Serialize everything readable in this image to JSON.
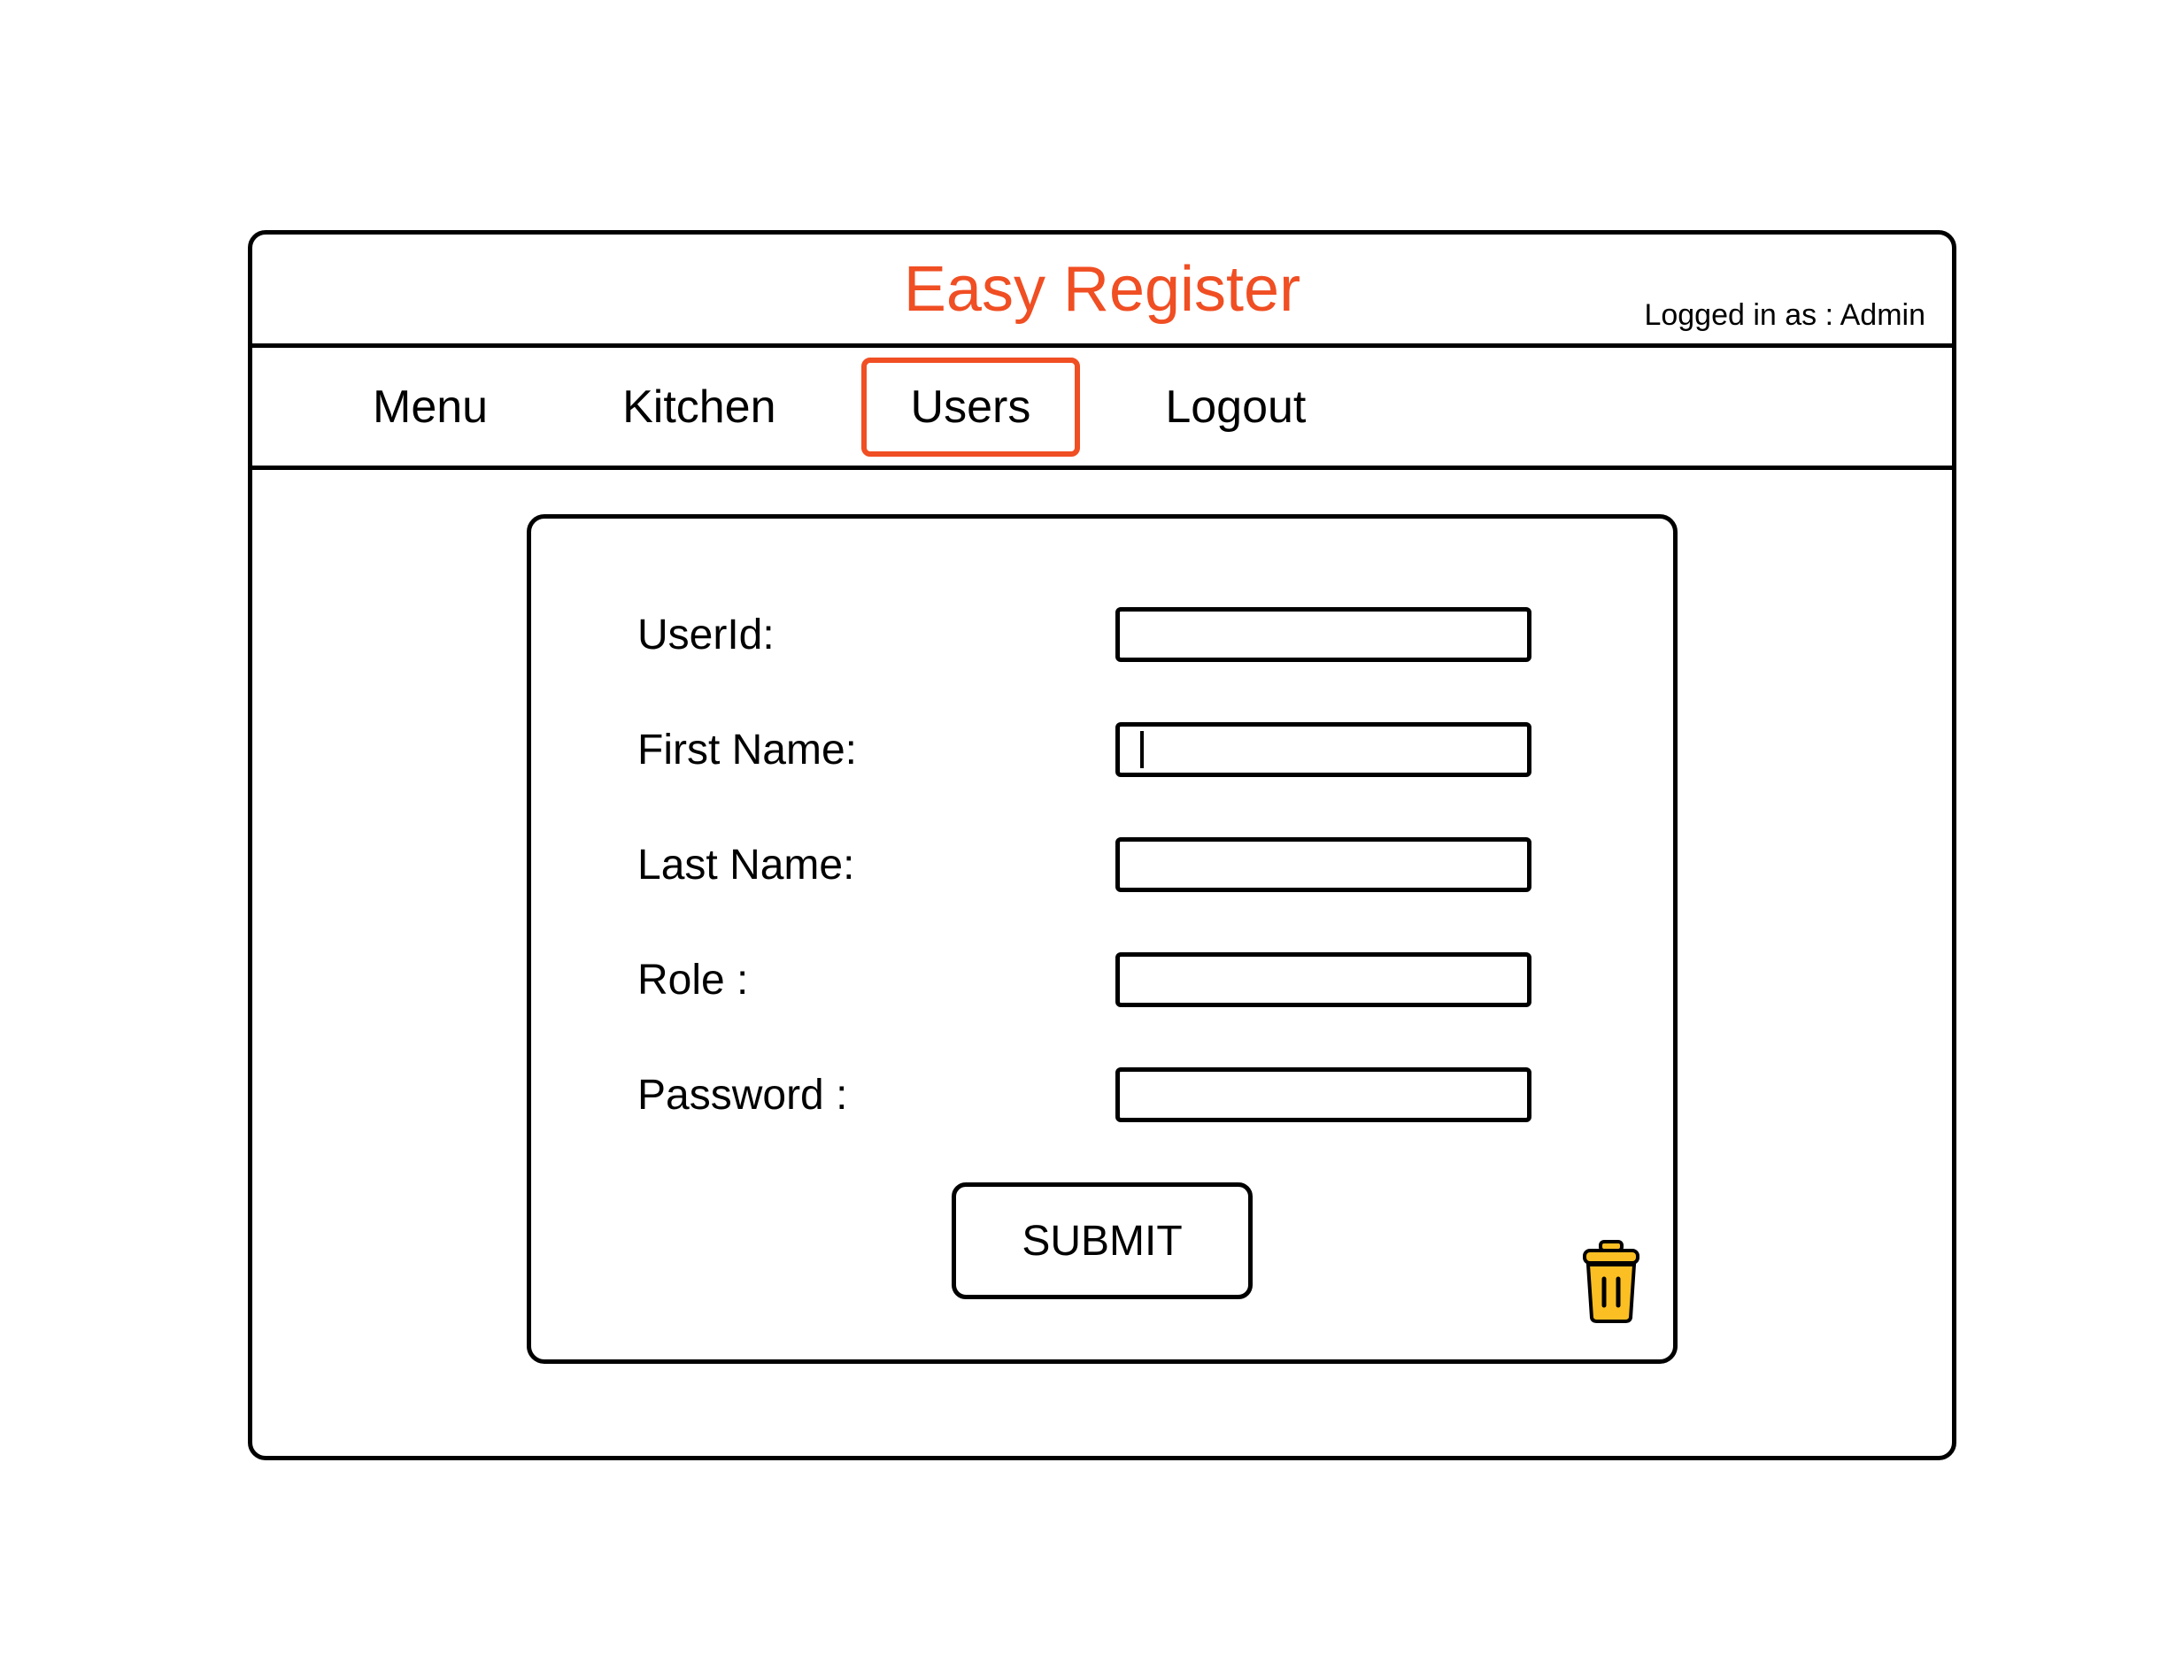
{
  "header": {
    "title": "Easy Register",
    "logged_in_prefix": "Logged in as :  ",
    "logged_in_user": "Admin"
  },
  "nav": {
    "items": [
      {
        "label": "Menu",
        "active": false
      },
      {
        "label": "Kitchen",
        "active": false
      },
      {
        "label": "Users",
        "active": true
      },
      {
        "label": "Logout",
        "active": false
      }
    ]
  },
  "form": {
    "fields": [
      {
        "label": "UserId:",
        "value": ""
      },
      {
        "label": "First Name:",
        "value": ""
      },
      {
        "label": "Last Name:",
        "value": ""
      },
      {
        "label": "Role :",
        "value": ""
      },
      {
        "label": "Password :",
        "value": ""
      }
    ],
    "submit_label": "SUBMIT"
  },
  "icons": {
    "trash": "trash-icon"
  },
  "colors": {
    "accent": "#f04e23",
    "trash_fill": "#fbbf24",
    "border": "#000000"
  }
}
